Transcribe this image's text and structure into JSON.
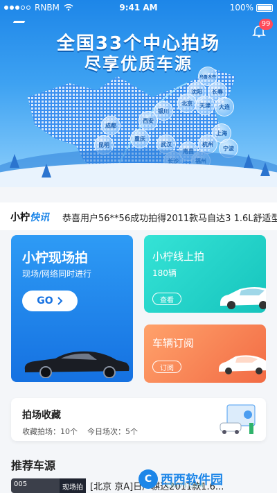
{
  "status_bar": {
    "carrier": "RNBM",
    "time": "9:41 AM",
    "battery": "100%"
  },
  "hero": {
    "title_line1": "全国33个中心拍场",
    "title_line2": "尽享优质车源",
    "notification_count": "99",
    "cities": [
      "乌鲁木齐",
      "沈阳",
      "长春",
      "北京",
      "天津",
      "大连",
      "银川",
      "西安",
      "成都",
      "昆明",
      "重庆",
      "武汉",
      "长沙",
      "南昌",
      "上海",
      "杭州",
      "宁波",
      "福州",
      "深圳",
      "东莞"
    ]
  },
  "news": {
    "brand_prefix": "小柠",
    "brand_suffix": "快讯",
    "text": "恭喜用户56**56成功拍得2011款马自达3 1.6L舒适型"
  },
  "cards": {
    "onsite": {
      "title": "小柠现场拍",
      "subtitle": "现场/网络同时进行",
      "button": "GO"
    },
    "online": {
      "title": "小柠线上拍",
      "count": "180辆",
      "button": "查看"
    },
    "subscribe": {
      "title": "车辆订阅",
      "button": "订阅"
    }
  },
  "favorites": {
    "title": "拍场收藏",
    "collected_label": "收藏拍场：",
    "collected_count": "10个",
    "today_label": "今日场次：",
    "today_count": "5个"
  },
  "recommend": {
    "title": "推荐车源",
    "item": {
      "number": "005",
      "tag": "现场拍",
      "text": "[北京 京A]日产骐达2011款1.6..."
    }
  },
  "watermark": {
    "logo": "C",
    "name": "西西软件园",
    "url": "CR173.COM"
  },
  "colors": {
    "primary": "#1d86e8",
    "teal": "#16c4bd",
    "orange": "#f26b44",
    "badge": "#ff4a5a"
  }
}
